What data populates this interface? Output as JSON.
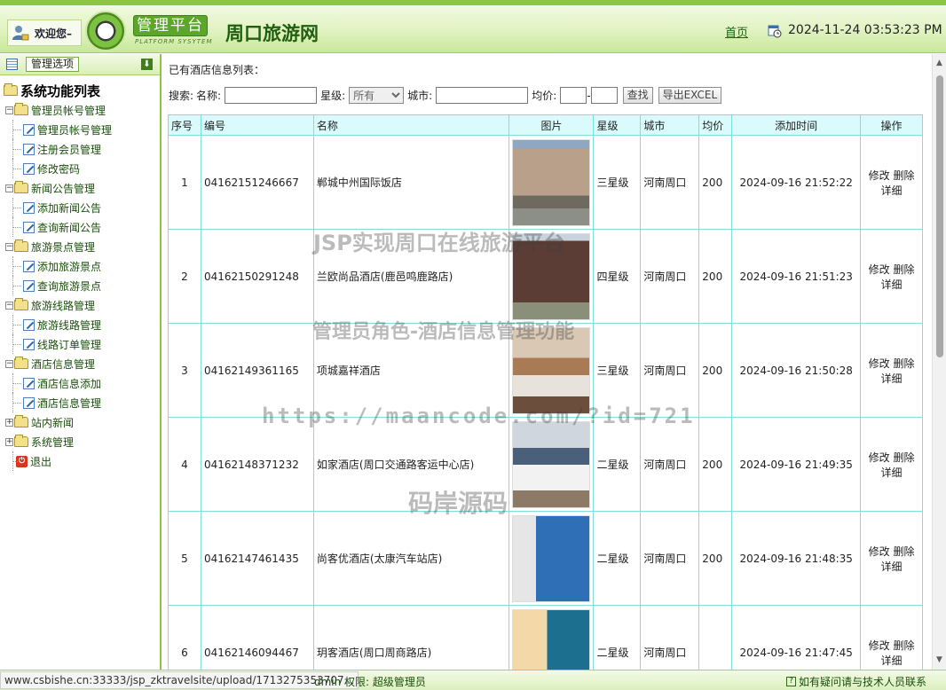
{
  "header": {
    "welcome": "欢迎您–",
    "platform_label": "管理平台",
    "platform_sub": "PLATFORM SYSYTEM",
    "site_title": "周口旅游网",
    "home_link": "首页",
    "datetime": "2024-11-24 03:53:23 PM"
  },
  "sidebar": {
    "title": "管理选项",
    "root": "系统功能列表",
    "groups": [
      {
        "label": "管理员帐号管理",
        "expanded": true,
        "items": [
          "管理员帐号管理",
          "注册会员管理",
          "修改密码"
        ]
      },
      {
        "label": "新闻公告管理",
        "expanded": true,
        "items": [
          "添加新闻公告",
          "查询新闻公告"
        ]
      },
      {
        "label": "旅游景点管理",
        "expanded": true,
        "items": [
          "添加旅游景点",
          "查询旅游景点"
        ]
      },
      {
        "label": "旅游线路管理",
        "expanded": true,
        "items": [
          "旅游线路管理",
          "线路订单管理"
        ]
      },
      {
        "label": "酒店信息管理",
        "expanded": true,
        "items": [
          "酒店信息添加",
          "酒店信息管理"
        ]
      },
      {
        "label": "站内新闻",
        "expanded": false,
        "items": []
      },
      {
        "label": "系统管理",
        "expanded": false,
        "items": []
      }
    ],
    "exit": "退出"
  },
  "main": {
    "list_title": "已有酒店信息列表：",
    "search": {
      "label": "搜索:",
      "name_label": "名称:",
      "name_value": "",
      "star_label": "星级:",
      "star_selected": "所有",
      "city_label": "城市:",
      "city_value": "",
      "price_label": "均价:",
      "price_sep": "-",
      "search_button": "查找",
      "export_button": "导出EXCEL"
    },
    "table": {
      "headers": [
        "序号",
        "编号",
        "名称",
        "图片",
        "星级",
        "城市",
        "均价",
        "添加时间",
        "操作"
      ],
      "rows": [
        {
          "no": "1",
          "code": "04162151246667",
          "name": "郸城中州国际饭店",
          "star": "三星级",
          "city": "河南周口",
          "price": "200",
          "time": "2024-09-16 21:52:22"
        },
        {
          "no": "2",
          "code": "04162150291248",
          "name": "兰欧尚品酒店(鹿邑鸣鹿路店)",
          "star": "四星级",
          "city": "河南周口",
          "price": "200",
          "time": "2024-09-16 21:51:23"
        },
        {
          "no": "3",
          "code": "04162149361165",
          "name": "项城嘉祥酒店",
          "star": "三星级",
          "city": "河南周口",
          "price": "200",
          "time": "2024-09-16 21:50:28"
        },
        {
          "no": "4",
          "code": "04162148371232",
          "name": "如家酒店(周口交通路客运中心店)",
          "star": "二星级",
          "city": "河南周口",
          "price": "200",
          "time": "2024-09-16 21:49:35"
        },
        {
          "no": "5",
          "code": "04162147461435",
          "name": "尚客优酒店(太康汽车站店)",
          "star": "二星级",
          "city": "河南周口",
          "price": "200",
          "time": "2024-09-16 21:48:35"
        },
        {
          "no": "6",
          "code": "04162146094467",
          "name": "玥客酒店(周口周商路店)",
          "star": "二星级",
          "city": "河南周口",
          "price": "",
          "time": "2024-09-16 21:47:45"
        }
      ],
      "op_edit": "修改",
      "op_delete": "删除",
      "op_detail": "详细"
    }
  },
  "watermarks": {
    "line1": "JSP实现周口在线旅游平台",
    "line2": "管理员角色-酒店信息管理功能",
    "line3": "https://maancode.com/?id=721",
    "line4": "码岸源码"
  },
  "statusbar": {
    "url": "www.csbishe.cn:33333/jsp_zktravelsite/upload/1713275353707...",
    "user_text": "dmin 权限:  超级管理员",
    "help_text": "如有疑问请与技术人员联系"
  },
  "colors": {
    "accent": "#8cc63f",
    "dark_green": "#1f5f0f",
    "table_header": "#d9fbfb",
    "table_border": "#7fdede"
  }
}
